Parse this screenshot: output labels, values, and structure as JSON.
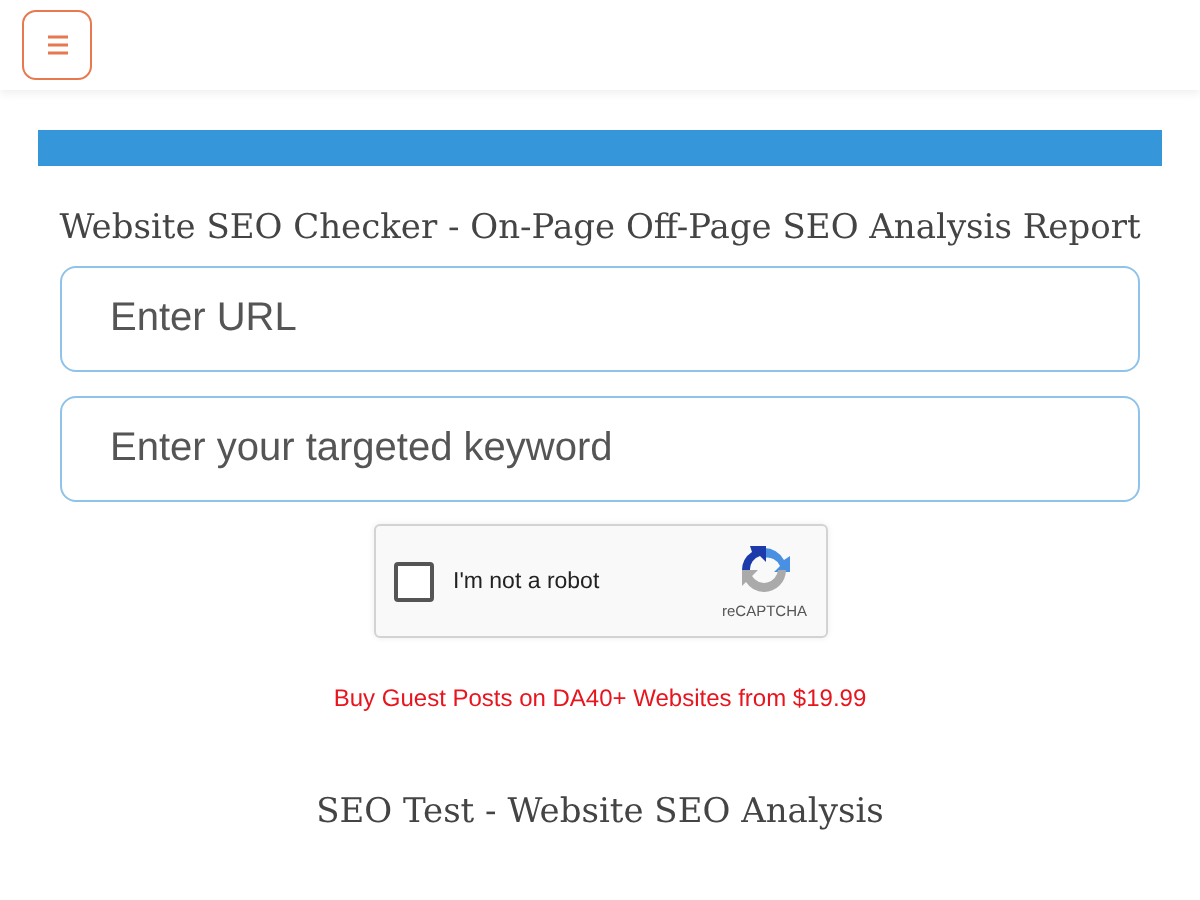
{
  "title": "Website SEO Checker - On-Page Off-Page SEO Analysis Report",
  "fields": [
    {
      "placeholder": "Enter URL"
    },
    {
      "placeholder": "Enter your targeted keyword"
    }
  ],
  "captcha": {
    "label": "I'm not a robot",
    "checked": false,
    "brand": "reCAPTCHA"
  },
  "promo_link": "Buy Guest Posts on DA40+ Websites from $19.99",
  "subtitle": "SEO Test - Website SEO Analysis"
}
